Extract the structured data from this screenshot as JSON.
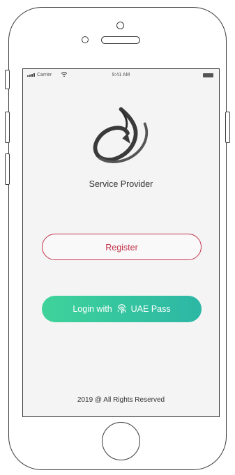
{
  "status_bar": {
    "carrier": "Carrier",
    "time": "9:41 AM"
  },
  "app": {
    "title": "Service Provider",
    "logo_icon": "swirl-logo-icon"
  },
  "buttons": {
    "register_label": "Register",
    "login_prefix": "Login with",
    "login_brand": "UAE Pass",
    "login_icon": "fingerprint-icon"
  },
  "footer": {
    "copyright": "2019 @ All Rights Reserved"
  },
  "colors": {
    "accent_red": "#c4354d",
    "gradient_start": "#3fd39a",
    "gradient_end": "#2cb7a5",
    "screen_bg": "#f4f4f4"
  }
}
